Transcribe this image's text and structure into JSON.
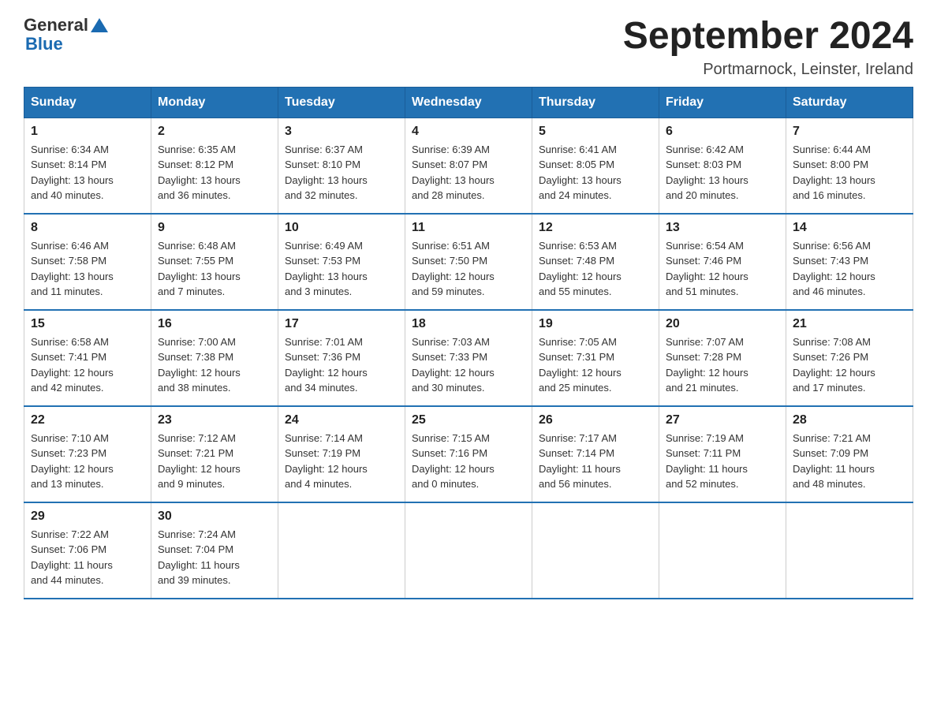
{
  "header": {
    "logo_general": "General",
    "logo_blue": "Blue",
    "title": "September 2024",
    "location": "Portmarnock, Leinster, Ireland"
  },
  "calendar": {
    "days_of_week": [
      "Sunday",
      "Monday",
      "Tuesday",
      "Wednesday",
      "Thursday",
      "Friday",
      "Saturday"
    ],
    "weeks": [
      [
        {
          "day": "1",
          "sunrise": "6:34 AM",
          "sunset": "8:14 PM",
          "daylight": "13 hours and 40 minutes."
        },
        {
          "day": "2",
          "sunrise": "6:35 AM",
          "sunset": "8:12 PM",
          "daylight": "13 hours and 36 minutes."
        },
        {
          "day": "3",
          "sunrise": "6:37 AM",
          "sunset": "8:10 PM",
          "daylight": "13 hours and 32 minutes."
        },
        {
          "day": "4",
          "sunrise": "6:39 AM",
          "sunset": "8:07 PM",
          "daylight": "13 hours and 28 minutes."
        },
        {
          "day": "5",
          "sunrise": "6:41 AM",
          "sunset": "8:05 PM",
          "daylight": "13 hours and 24 minutes."
        },
        {
          "day": "6",
          "sunrise": "6:42 AM",
          "sunset": "8:03 PM",
          "daylight": "13 hours and 20 minutes."
        },
        {
          "day": "7",
          "sunrise": "6:44 AM",
          "sunset": "8:00 PM",
          "daylight": "13 hours and 16 minutes."
        }
      ],
      [
        {
          "day": "8",
          "sunrise": "6:46 AM",
          "sunset": "7:58 PM",
          "daylight": "13 hours and 11 minutes."
        },
        {
          "day": "9",
          "sunrise": "6:48 AM",
          "sunset": "7:55 PM",
          "daylight": "13 hours and 7 minutes."
        },
        {
          "day": "10",
          "sunrise": "6:49 AM",
          "sunset": "7:53 PM",
          "daylight": "13 hours and 3 minutes."
        },
        {
          "day": "11",
          "sunrise": "6:51 AM",
          "sunset": "7:50 PM",
          "daylight": "12 hours and 59 minutes."
        },
        {
          "day": "12",
          "sunrise": "6:53 AM",
          "sunset": "7:48 PM",
          "daylight": "12 hours and 55 minutes."
        },
        {
          "day": "13",
          "sunrise": "6:54 AM",
          "sunset": "7:46 PM",
          "daylight": "12 hours and 51 minutes."
        },
        {
          "day": "14",
          "sunrise": "6:56 AM",
          "sunset": "7:43 PM",
          "daylight": "12 hours and 46 minutes."
        }
      ],
      [
        {
          "day": "15",
          "sunrise": "6:58 AM",
          "sunset": "7:41 PM",
          "daylight": "12 hours and 42 minutes."
        },
        {
          "day": "16",
          "sunrise": "7:00 AM",
          "sunset": "7:38 PM",
          "daylight": "12 hours and 38 minutes."
        },
        {
          "day": "17",
          "sunrise": "7:01 AM",
          "sunset": "7:36 PM",
          "daylight": "12 hours and 34 minutes."
        },
        {
          "day": "18",
          "sunrise": "7:03 AM",
          "sunset": "7:33 PM",
          "daylight": "12 hours and 30 minutes."
        },
        {
          "day": "19",
          "sunrise": "7:05 AM",
          "sunset": "7:31 PM",
          "daylight": "12 hours and 25 minutes."
        },
        {
          "day": "20",
          "sunrise": "7:07 AM",
          "sunset": "7:28 PM",
          "daylight": "12 hours and 21 minutes."
        },
        {
          "day": "21",
          "sunrise": "7:08 AM",
          "sunset": "7:26 PM",
          "daylight": "12 hours and 17 minutes."
        }
      ],
      [
        {
          "day": "22",
          "sunrise": "7:10 AM",
          "sunset": "7:23 PM",
          "daylight": "12 hours and 13 minutes."
        },
        {
          "day": "23",
          "sunrise": "7:12 AM",
          "sunset": "7:21 PM",
          "daylight": "12 hours and 9 minutes."
        },
        {
          "day": "24",
          "sunrise": "7:14 AM",
          "sunset": "7:19 PM",
          "daylight": "12 hours and 4 minutes."
        },
        {
          "day": "25",
          "sunrise": "7:15 AM",
          "sunset": "7:16 PM",
          "daylight": "12 hours and 0 minutes."
        },
        {
          "day": "26",
          "sunrise": "7:17 AM",
          "sunset": "7:14 PM",
          "daylight": "11 hours and 56 minutes."
        },
        {
          "day": "27",
          "sunrise": "7:19 AM",
          "sunset": "7:11 PM",
          "daylight": "11 hours and 52 minutes."
        },
        {
          "day": "28",
          "sunrise": "7:21 AM",
          "sunset": "7:09 PM",
          "daylight": "11 hours and 48 minutes."
        }
      ],
      [
        {
          "day": "29",
          "sunrise": "7:22 AM",
          "sunset": "7:06 PM",
          "daylight": "11 hours and 44 minutes."
        },
        {
          "day": "30",
          "sunrise": "7:24 AM",
          "sunset": "7:04 PM",
          "daylight": "11 hours and 39 minutes."
        },
        null,
        null,
        null,
        null,
        null
      ]
    ]
  },
  "labels": {
    "sunrise_prefix": "Sunrise: ",
    "sunset_prefix": "Sunset: ",
    "daylight_prefix": "Daylight: "
  }
}
